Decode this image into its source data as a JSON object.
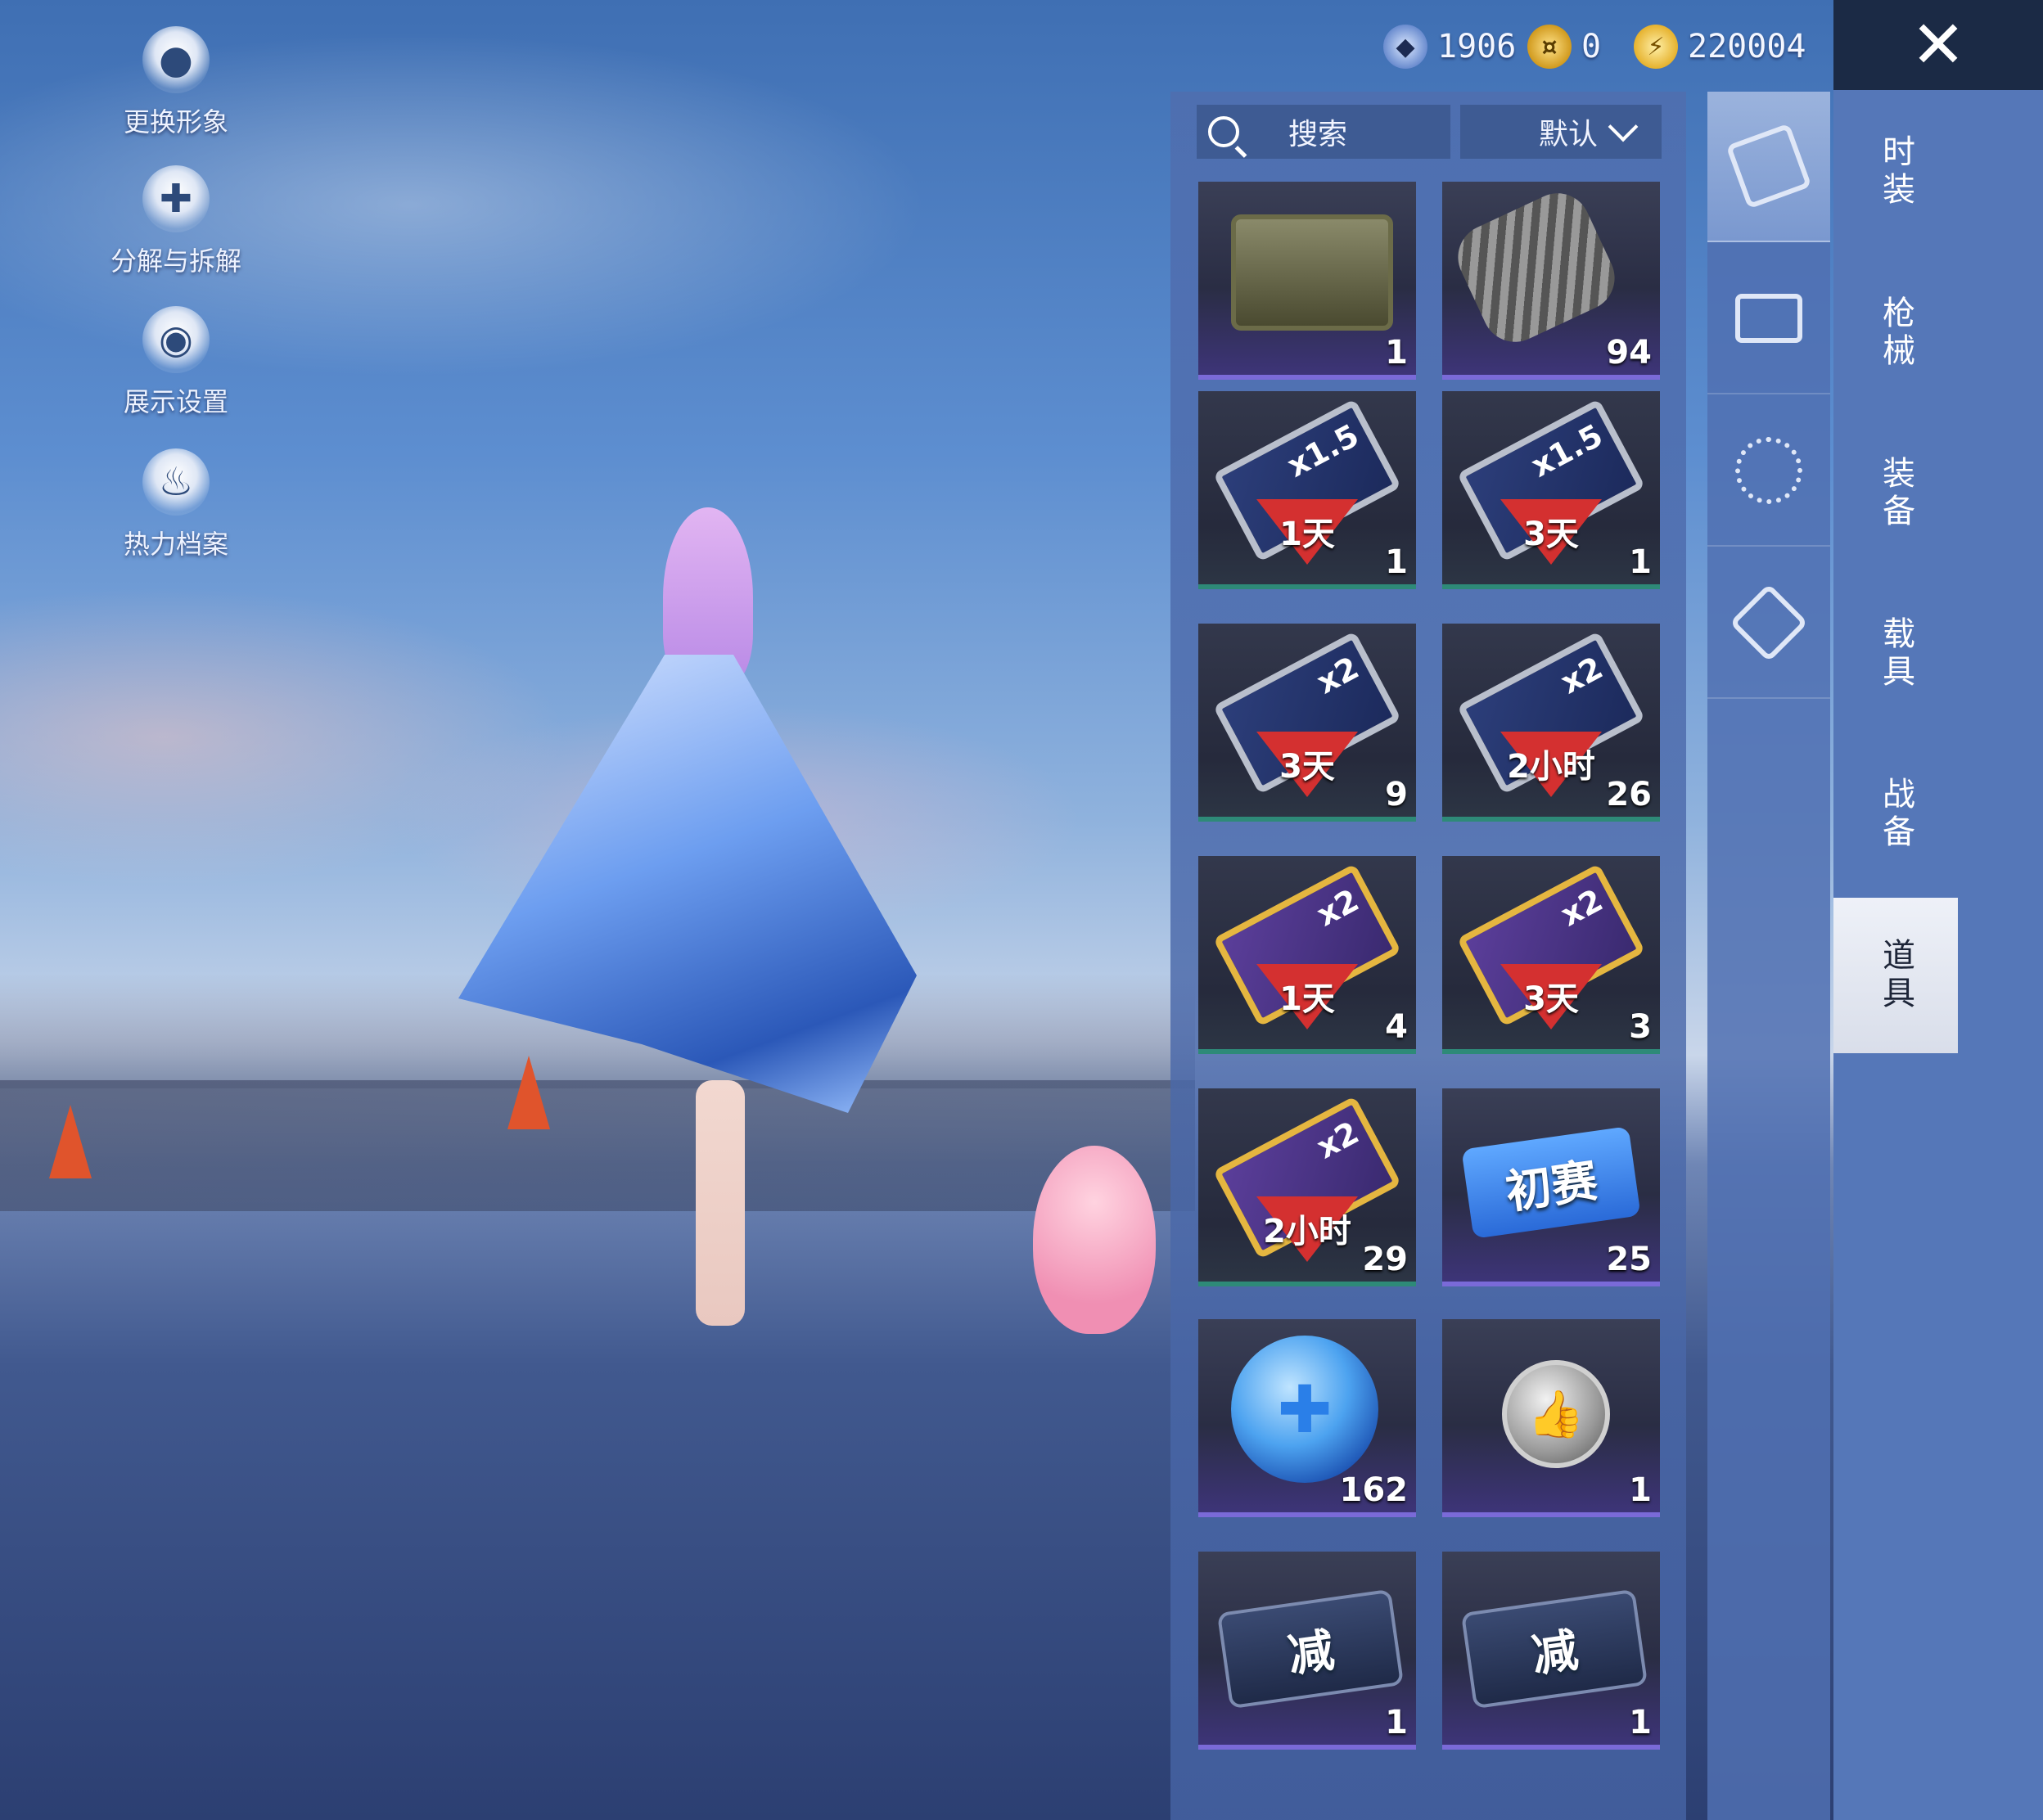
{
  "currency": [
    {
      "icon": "medal-icon",
      "value": "1906",
      "color": "#8fb6e8"
    },
    {
      "icon": "gold-coin-icon",
      "value": "0",
      "color": "#e0b23a"
    },
    {
      "icon": "lightning-coin-icon",
      "value": "220004",
      "color": "#e8c24a"
    }
  ],
  "side_menu": [
    {
      "icon": "avatar-icon",
      "label": "更换形象"
    },
    {
      "icon": "puzzle-icon",
      "label": "分解与拆解"
    },
    {
      "icon": "eye-icon",
      "label": "展示设置"
    },
    {
      "icon": "flame-icon",
      "label": "热力档案"
    }
  ],
  "search": {
    "label": "搜索"
  },
  "sort": {
    "label": "默认"
  },
  "close": {
    "glyph": "✕"
  },
  "items": [
    {
      "kind": "crate",
      "count": "1"
    },
    {
      "kind": "spring",
      "count": "94"
    },
    {
      "kind": "exp-card",
      "mult": "x1.5",
      "duration": "1天",
      "count": "1"
    },
    {
      "kind": "exp-card",
      "mult": "x1.5",
      "duration": "3天",
      "count": "1"
    },
    {
      "kind": "exp-card",
      "mult": "x2",
      "duration": "3天",
      "count": "9"
    },
    {
      "kind": "exp-card",
      "mult": "x2",
      "duration": "2小时",
      "count": "26"
    },
    {
      "kind": "coin-card",
      "mult": "x2",
      "duration": "1天",
      "count": "4"
    },
    {
      "kind": "coin-card",
      "mult": "x2",
      "duration": "3天",
      "count": "3"
    },
    {
      "kind": "coin-card",
      "mult": "x2",
      "duration": "2小时",
      "count": "29"
    },
    {
      "kind": "ticket",
      "label": "初赛",
      "count": "25"
    },
    {
      "kind": "orb",
      "count": "162"
    },
    {
      "kind": "thumb-badge",
      "count": "1"
    },
    {
      "kind": "discount-ticket",
      "label": "减",
      "count": "1"
    },
    {
      "kind": "discount-ticket",
      "label": "减",
      "count": "1"
    }
  ],
  "categories": [
    {
      "icon": "card-icon",
      "active": true
    },
    {
      "icon": "chest-icon",
      "active": false
    },
    {
      "icon": "firework-icon",
      "active": false
    },
    {
      "icon": "diamond-tag-icon",
      "active": false
    }
  ],
  "nav_tabs": [
    {
      "label": "时装",
      "active": false
    },
    {
      "label": "枪械",
      "active": false
    },
    {
      "label": "装备",
      "active": false
    },
    {
      "label": "载具",
      "active": false
    },
    {
      "label": "战备",
      "active": false
    },
    {
      "label": "道具",
      "active": true
    }
  ]
}
